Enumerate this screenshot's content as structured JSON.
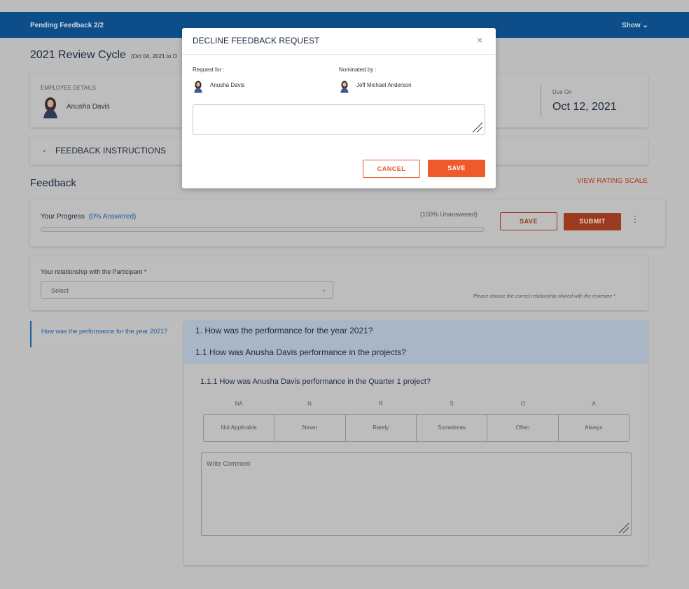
{
  "topbar": {
    "pending": "Pending Feedback 2/2",
    "show": "Show ⌄"
  },
  "cycle": {
    "title": "2021 Review Cycle",
    "range": "(Oct 04, 2021 to O"
  },
  "employee": {
    "label": "EMPLOYEE DETAILS",
    "name": "Anusha Davis",
    "due_label": "Due On",
    "due_date": "Oct 12, 2021"
  },
  "instructions": {
    "chevron": "⌄",
    "label": "FEEDBACK INSTRUCTIONS"
  },
  "feedback": {
    "title": "Feedback",
    "view_rating_scale": "VIEW RATING SCALE"
  },
  "progress": {
    "label": "Your Progress",
    "answered": "(0% Answered)",
    "unanswered": "(100% Unanswered)",
    "fraction": 0,
    "save": "SAVE",
    "submit": "SUBMIT",
    "more": "⋮"
  },
  "relationship": {
    "label": "Your relationship with the Participant *",
    "selected": "Select",
    "hint": "Please choose the correct relationship shared with the reviewee *"
  },
  "sidebar": {
    "item": "How was the performance for the year 2021?"
  },
  "questions": {
    "q1": "1. How was the performance for the year 2021?",
    "q11": "1.1 How was Anusha Davis performance in the projects?",
    "q111": "1.1.1 How was Anusha Davis performance in the Quarter 1 project?"
  },
  "scale": {
    "abbr": [
      "NA",
      "N",
      "R",
      "S",
      "O",
      "A"
    ],
    "options": [
      "Not Applicable",
      "Never",
      "Rarely",
      "Sometimes",
      "Often",
      "Always"
    ]
  },
  "comment": {
    "placeholder": "Write Comment"
  },
  "modal": {
    "title": "DECLINE FEEDBACK REQUEST",
    "close": "×",
    "request_for_label": "Request for :",
    "request_for_name": "Anusha Davis",
    "nominated_by_label": "Nominated by :",
    "nominated_by_name": "Jeff Michael Anderson",
    "cancel": "CANCEL",
    "save": "SAVE"
  },
  "colors": {
    "topbar": "#0d4e8a",
    "accent": "#ee5a2a",
    "link": "#1f5f9d"
  }
}
